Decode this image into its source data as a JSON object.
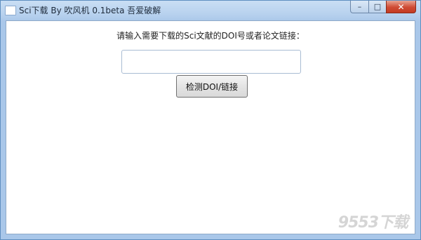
{
  "window": {
    "title": "Sci下载 By 吹风机 0.1beta 吾爱破解",
    "controls": {
      "minimize": "–",
      "maximize": "□",
      "close": "✕"
    }
  },
  "main": {
    "prompt": "请输入需要下载的Sci文献的DOI号或者论文链接：",
    "doi_input": {
      "value": "",
      "placeholder": ""
    },
    "detect_button_label": "检测DOI/链接"
  },
  "watermark": "9553下载"
}
